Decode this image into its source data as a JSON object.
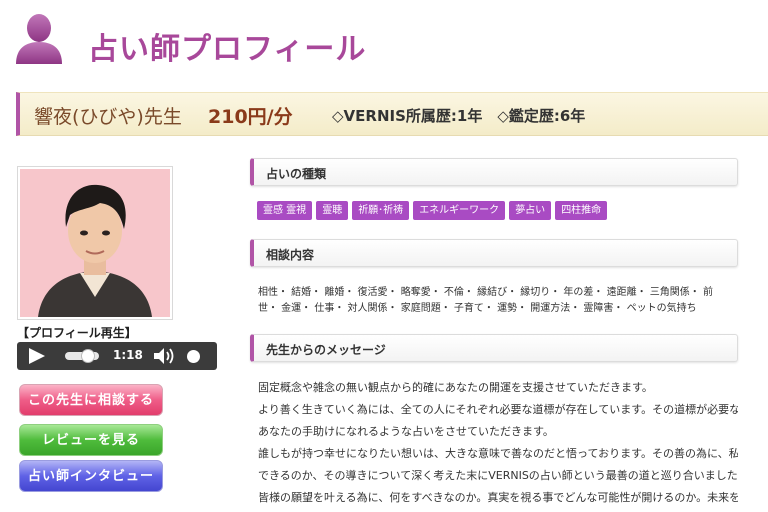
{
  "page": {
    "title": "占い師プロフィール"
  },
  "name_bar": {
    "teacher_name": "響夜(ひびや)先生",
    "price": "210円/分",
    "history": "◇VERNIS所属歴:1年　◇鑑定歴:6年"
  },
  "profile": {
    "play_label": "【プロフィール再生】",
    "audio_time": "1:18"
  },
  "buttons": {
    "consult": "この先生に相談する",
    "review": "レビューを見る",
    "interview": "占い師インタビュー"
  },
  "sections": {
    "types_title": "占いの種類",
    "consult_title": "相談内容",
    "message_title": "先生からのメッセージ"
  },
  "tags": [
    "霊感 霊視",
    "霊聴",
    "祈願･祈祷",
    "エネルギーワーク",
    "夢占い",
    "四柱推命"
  ],
  "consult_text": "相性・ 結婚・ 離婚・ 復活愛・ 略奪愛・ 不倫・ 縁結び・ 縁切り・ 年の差・ 遠距離・ 三角関係・ 前世・ 金運・ 仕事・ 対人関係・ 家庭問題・ 子育て・ 運勢・ 開運方法・ 霊障害・ ペットの気持ち",
  "message": [
    "固定概念や雑念の無い観点から的確にあなたの開運を支援させていただきます。",
    "より善く生きていく為には、全ての人にそれぞれ必要な道標が存在しています。その道標が必要な時に、",
    "あなたの手助けになれるような占いをさせていただきます。",
    "誰しもが持つ幸せになりたい想いは、大きな意味で善なのだと悟っております。その善の為に、私に何が",
    "できるのか、その導きについて深く考えた末にVERNISの占い師という最善の道と巡り合いました。",
    "皆様の願望を叶える為に、何をすべきなのか。真実を視る事でどんな可能性が開けるのか。未来を明る"
  ],
  "colors": {
    "accent": "#b054a6",
    "title": "#a8489a",
    "tag": "#a94bc3"
  }
}
